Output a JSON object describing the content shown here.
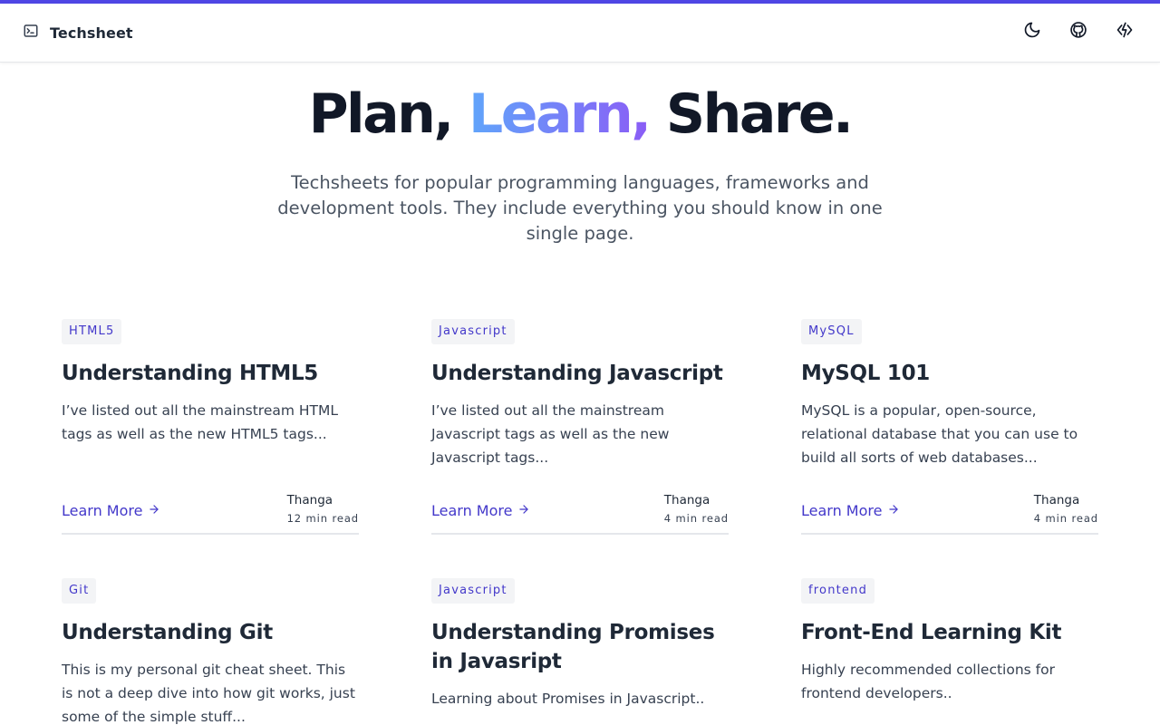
{
  "nav": {
    "brand": "Techsheet",
    "icons": [
      "terminal-icon",
      "moon-icon",
      "github-icon",
      "lightning-icon"
    ]
  },
  "hero": {
    "title_part1": "Plan,",
    "title_part2": "Learn,",
    "title_part3": "Share.",
    "subtitle": "Techsheets for popular programming languages, frameworks and development tools. They include everything you should know in one single page."
  },
  "colors": {
    "accent": "#4f46e5",
    "link": "#4338ca",
    "gradient_start": "#60a5fa",
    "gradient_end": "#8b5cf6"
  },
  "cards": [
    {
      "tag": "HTML5",
      "title": "Understanding HTML5",
      "desc": "I’ve listed out all the mainstream HTML tags as well as the new HTML5 tags...",
      "learn": "Learn More",
      "author": "Thanga",
      "read": "12 min read"
    },
    {
      "tag": "Javascript",
      "title": "Understanding Javascript",
      "desc": "I’ve listed out all the mainstream Javascript tags as well as the new Javascript tags...",
      "learn": "Learn More",
      "author": "Thanga",
      "read": "4 min read"
    },
    {
      "tag": "MySQL",
      "title": "MySQL 101",
      "desc": "MySQL is a popular, open-source, relational database that you can use to build all sorts of web databases...",
      "learn": "Learn More",
      "author": "Thanga",
      "read": "4 min read"
    },
    {
      "tag": "Git",
      "title": "Understanding Git",
      "desc": "This is my personal git cheat sheet. This is not a deep dive into how git works, just some of the simple stuff..."
    },
    {
      "tag": "Javascript",
      "title": "Understanding Promises in Javasript",
      "desc": "Learning about Promises in Javascript.."
    },
    {
      "tag": "frontend",
      "title": "Front-End Learning Kit",
      "desc": "Highly recommended collections for frontend developers.."
    }
  ]
}
